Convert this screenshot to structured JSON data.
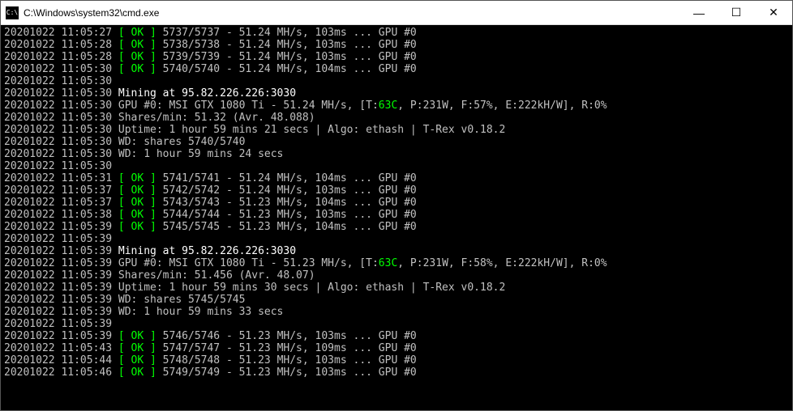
{
  "window": {
    "title": "C:\\Windows\\system32\\cmd.exe",
    "icon_label": "cmd-icon"
  },
  "buttons": {
    "minimize": "—",
    "maximize": "☐",
    "close": "✕"
  },
  "lines": [
    {
      "type": "share",
      "ts": "20201022 11:05:27",
      "ok": "[ OK ]",
      "body": " 5737/5737 - 51.24 MH/s, 103ms ... GPU #0"
    },
    {
      "type": "share",
      "ts": "20201022 11:05:28",
      "ok": "[ OK ]",
      "body": " 5738/5738 - 51.24 MH/s, 103ms ... GPU #0"
    },
    {
      "type": "share",
      "ts": "20201022 11:05:28",
      "ok": "[ OK ]",
      "body": " 5739/5739 - 51.24 MH/s, 103ms ... GPU #0"
    },
    {
      "type": "share",
      "ts": "20201022 11:05:30",
      "ok": "[ OK ]",
      "body": " 5740/5740 - 51.24 MH/s, 104ms ... GPU #0"
    },
    {
      "type": "plain",
      "ts": "20201022 11:05:30",
      "body": ""
    },
    {
      "type": "mining",
      "ts": "20201022 11:05:30",
      "body": " Mining at 95.82.226.226:3030"
    },
    {
      "type": "gpu",
      "ts": "20201022 11:05:30",
      "pre": " GPU #0: MSI GTX 1080 Ti - 51.24 MH/s, [T:",
      "temp": "63C",
      "post": ", P:231W, F:57%, E:222kH/W], R:0%"
    },
    {
      "type": "plain",
      "ts": "20201022 11:05:30",
      "body": " Shares/min: 51.32 (Avr. 48.088)"
    },
    {
      "type": "plain",
      "ts": "20201022 11:05:30",
      "body": " Uptime: 1 hour 59 mins 21 secs | Algo: ethash | T-Rex v0.18.2"
    },
    {
      "type": "plain",
      "ts": "20201022 11:05:30",
      "body": " WD: shares 5740/5740"
    },
    {
      "type": "plain",
      "ts": "20201022 11:05:30",
      "body": " WD: 1 hour 59 mins 24 secs"
    },
    {
      "type": "plain",
      "ts": "20201022 11:05:30",
      "body": ""
    },
    {
      "type": "share",
      "ts": "20201022 11:05:31",
      "ok": "[ OK ]",
      "body": " 5741/5741 - 51.24 MH/s, 104ms ... GPU #0"
    },
    {
      "type": "share",
      "ts": "20201022 11:05:37",
      "ok": "[ OK ]",
      "body": " 5742/5742 - 51.24 MH/s, 103ms ... GPU #0"
    },
    {
      "type": "share",
      "ts": "20201022 11:05:37",
      "ok": "[ OK ]",
      "body": " 5743/5743 - 51.23 MH/s, 104ms ... GPU #0"
    },
    {
      "type": "share",
      "ts": "20201022 11:05:38",
      "ok": "[ OK ]",
      "body": " 5744/5744 - 51.23 MH/s, 103ms ... GPU #0"
    },
    {
      "type": "share",
      "ts": "20201022 11:05:39",
      "ok": "[ OK ]",
      "body": " 5745/5745 - 51.23 MH/s, 104ms ... GPU #0"
    },
    {
      "type": "plain",
      "ts": "20201022 11:05:39",
      "body": ""
    },
    {
      "type": "mining",
      "ts": "20201022 11:05:39",
      "body": " Mining at 95.82.226.226:3030"
    },
    {
      "type": "gpu",
      "ts": "20201022 11:05:39",
      "pre": " GPU #0: MSI GTX 1080 Ti - 51.23 MH/s, [T:",
      "temp": "63C",
      "post": ", P:231W, F:58%, E:222kH/W], R:0%"
    },
    {
      "type": "plain",
      "ts": "20201022 11:05:39",
      "body": " Shares/min: 51.456 (Avr. 48.07)"
    },
    {
      "type": "plain",
      "ts": "20201022 11:05:39",
      "body": " Uptime: 1 hour 59 mins 30 secs | Algo: ethash | T-Rex v0.18.2"
    },
    {
      "type": "plain",
      "ts": "20201022 11:05:39",
      "body": " WD: shares 5745/5745"
    },
    {
      "type": "plain",
      "ts": "20201022 11:05:39",
      "body": " WD: 1 hour 59 mins 33 secs"
    },
    {
      "type": "plain",
      "ts": "20201022 11:05:39",
      "body": ""
    },
    {
      "type": "share",
      "ts": "20201022 11:05:39",
      "ok": "[ OK ]",
      "body": " 5746/5746 - 51.23 MH/s, 103ms ... GPU #0"
    },
    {
      "type": "share",
      "ts": "20201022 11:05:43",
      "ok": "[ OK ]",
      "body": " 5747/5747 - 51.23 MH/s, 109ms ... GPU #0"
    },
    {
      "type": "share",
      "ts": "20201022 11:05:44",
      "ok": "[ OK ]",
      "body": " 5748/5748 - 51.23 MH/s, 103ms ... GPU #0"
    },
    {
      "type": "share",
      "ts": "20201022 11:05:46",
      "ok": "[ OK ]",
      "body": " 5749/5749 - 51.23 MH/s, 103ms ... GPU #0"
    }
  ]
}
